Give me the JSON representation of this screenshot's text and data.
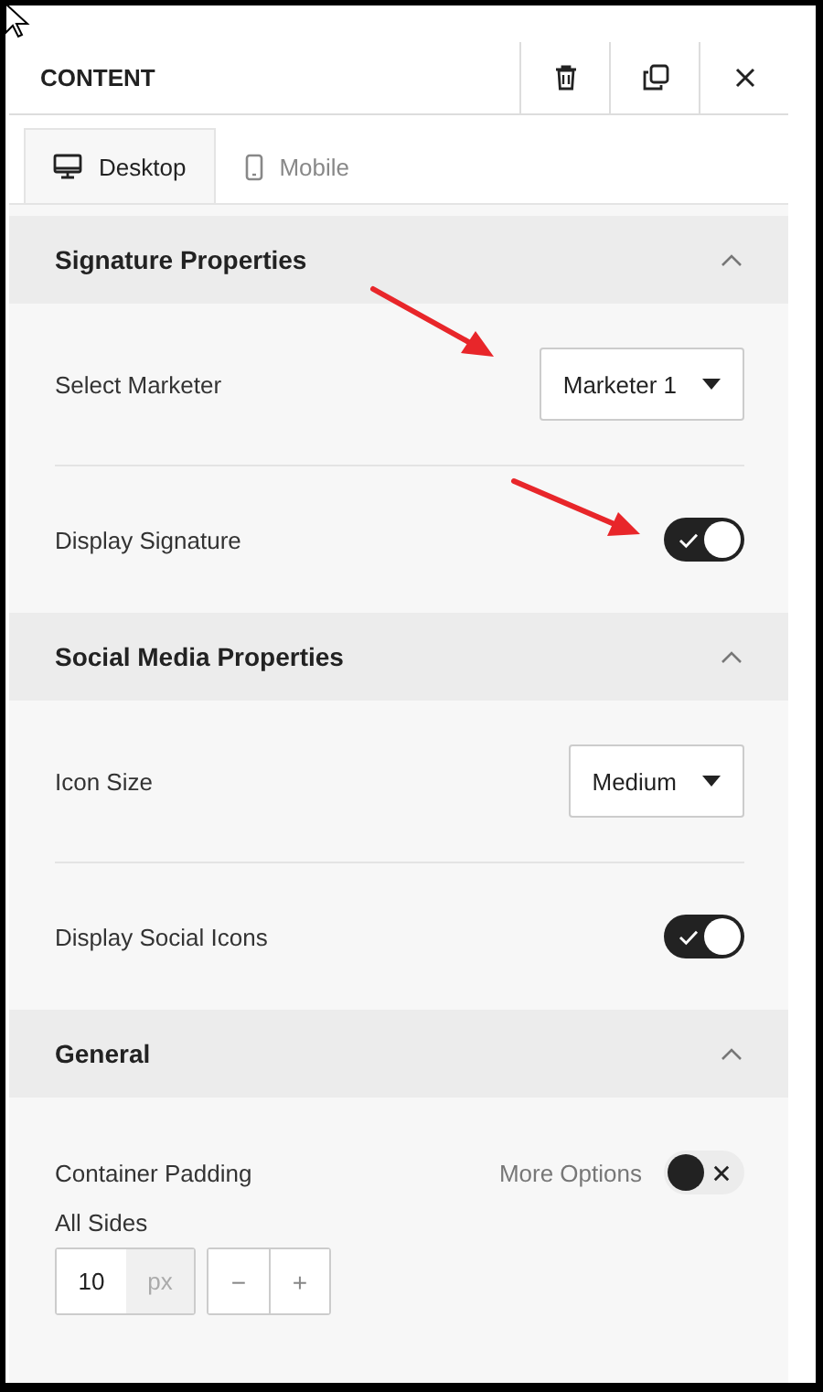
{
  "panel": {
    "title": "CONTENT"
  },
  "tabs": [
    {
      "label": "Desktop",
      "kind": "desktop",
      "selected": true
    },
    {
      "label": "Mobile",
      "kind": "mobile",
      "selected": false
    }
  ],
  "sections": [
    {
      "title": "Signature Properties",
      "expanded": true,
      "rows": [
        {
          "kind": "select",
          "label": "Select Marketer",
          "value": "Marketer 1"
        },
        {
          "kind": "toggle",
          "label": "Display Signature",
          "on": true
        }
      ]
    },
    {
      "title": "Social Media Properties",
      "expanded": true,
      "rows": [
        {
          "kind": "select",
          "label": "Icon Size",
          "value": "Medium"
        },
        {
          "kind": "toggle",
          "label": "Display Social Icons",
          "on": true
        }
      ]
    },
    {
      "title": "General",
      "expanded": true,
      "rows": [
        {
          "kind": "padding",
          "label": "Container Padding",
          "more_options": "More Options",
          "on": false,
          "sublabel": "All Sides",
          "value": "10",
          "unit": "px",
          "decrement": "−",
          "increment": "+"
        }
      ]
    }
  ]
}
